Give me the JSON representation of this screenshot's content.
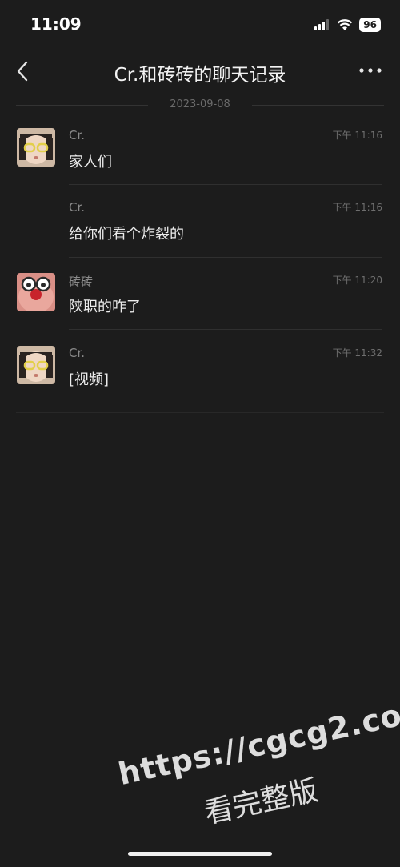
{
  "status_bar": {
    "time": "11:09",
    "battery": "96"
  },
  "nav": {
    "title": "Cr.和砖砖的聊天记录"
  },
  "date_separator": "2023-09-08",
  "messages": [
    {
      "sender": "Cr.",
      "time": "下午 11:16",
      "text": "家人们",
      "avatar": "girl-glasses"
    },
    {
      "sender": "Cr.",
      "time": "下午 11:16",
      "text": "给你们看个炸裂的",
      "avatar": ""
    },
    {
      "sender": "砖砖",
      "time": "下午 11:20",
      "text": "陕职的咋了",
      "avatar": "pink-clown"
    },
    {
      "sender": "Cr.",
      "time": "下午 11:32",
      "text": "[视频]",
      "avatar": "girl-glasses"
    }
  ],
  "watermark": {
    "url": "https://cgcg2.co",
    "text": "看完整版"
  }
}
